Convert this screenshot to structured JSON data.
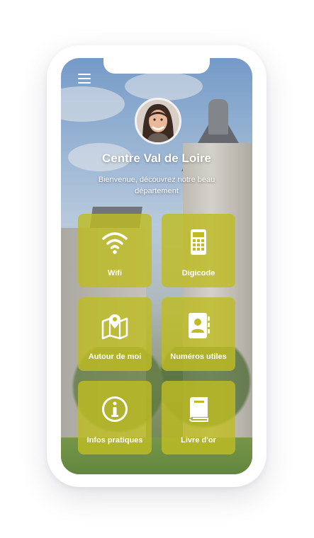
{
  "header": {
    "title": "Centre Val de Loire",
    "subtitle": "Bienvenue, découvrez notre beau département"
  },
  "menu": {
    "icon": "hamburger-menu-icon"
  },
  "avatar": {
    "icon": "woman-portrait"
  },
  "tiles": [
    {
      "label": "Wifi",
      "icon": "wifi-icon"
    },
    {
      "label": "Digicode",
      "icon": "keypad-icon"
    },
    {
      "label": "Autour de moi",
      "icon": "map-pin-icon"
    },
    {
      "label": "Numéros utiles",
      "icon": "contacts-book-icon"
    },
    {
      "label": "Infos pratiques",
      "icon": "info-icon"
    },
    {
      "label": "Livre d'or",
      "icon": "book-icon"
    }
  ],
  "colors": {
    "tile": "#bebc22",
    "text": "#ffffff"
  }
}
